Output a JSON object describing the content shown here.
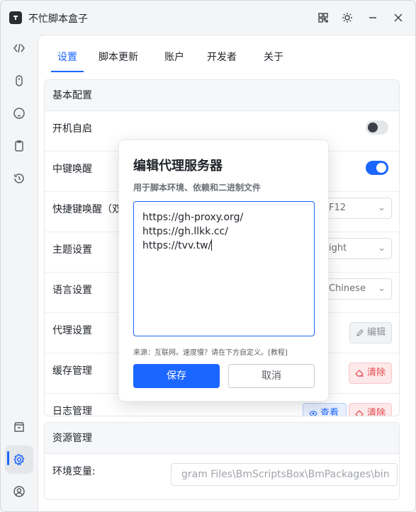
{
  "window": {
    "title": "不忙脚本盒子"
  },
  "sidebar": {
    "items": [
      {
        "icon": "code-icon"
      },
      {
        "icon": "mouse-icon"
      },
      {
        "icon": "keyboard-icon"
      },
      {
        "icon": "clipboard-icon"
      },
      {
        "icon": "history-icon"
      },
      {
        "icon": "store-icon"
      },
      {
        "icon": "settings-icon",
        "active": true
      },
      {
        "icon": "user-icon"
      }
    ]
  },
  "tabs": [
    {
      "label": "设置",
      "active": true
    },
    {
      "label": "脚本更新"
    },
    {
      "label": "账户"
    },
    {
      "label": "开发者"
    },
    {
      "label": "关于"
    }
  ],
  "basic": {
    "header": "基本配置",
    "startup": {
      "label": "开机自启",
      "enabled": false
    },
    "middle_click": {
      "label": "中键唤醒",
      "enabled": true
    },
    "hotkey": {
      "label": "快捷键唤醒（双",
      "value": "F12"
    },
    "theme": {
      "label": "主题设置",
      "value": "ight"
    },
    "language": {
      "label": "语言设置",
      "value": "Chinese"
    },
    "proxy": {
      "label": "代理设置",
      "edit_label": "编辑"
    },
    "cache": {
      "label": "缓存管理",
      "clear_label": "清除"
    },
    "log": {
      "label": "日志管理",
      "view_label": "查看",
      "clear_label": "清除"
    }
  },
  "resources": {
    "header": "资源管理",
    "env": {
      "label": "环境变量:",
      "value": "gram Files\\BmScriptsBox\\BmPackages\\bin"
    }
  },
  "dialog": {
    "title": "编辑代理服务器",
    "subtitle": "用于脚本环境、依赖和二进制文件",
    "lines": [
      "https://gh-proxy.org/",
      "https://gh.llkk.cc/",
      "https://tvv.tw/"
    ],
    "note": "来源：互联网。速度慢？请在下方自定义。[教程]",
    "save_label": "保存",
    "cancel_label": "取消"
  },
  "colors": {
    "accent": "#1a66ff",
    "danger": "#e5484d"
  }
}
